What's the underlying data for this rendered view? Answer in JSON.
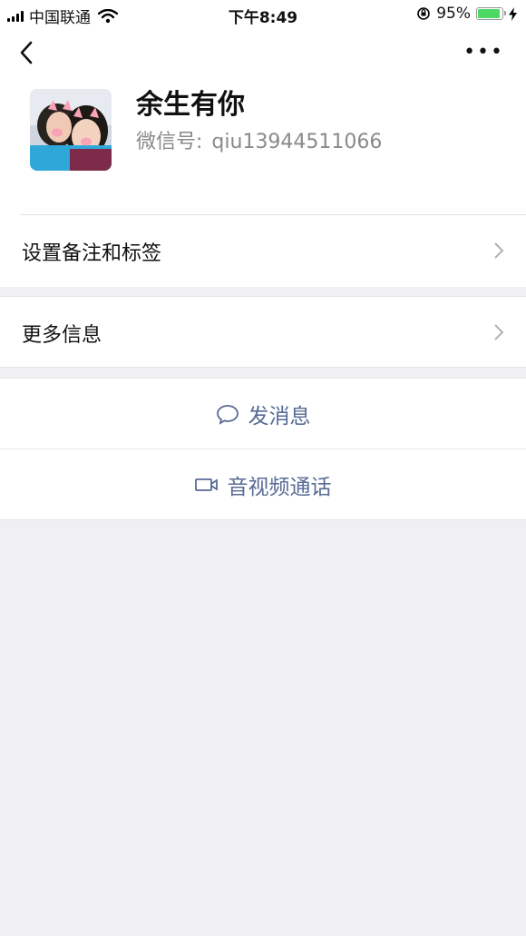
{
  "status": {
    "carrier": "中国联通",
    "time": "下午8:49",
    "battery": "95%",
    "battery_level": 0.95,
    "battery_color": "#4cd964"
  },
  "nav": {
    "back_icon": "chevron-left-icon",
    "more_icon": "ellipsis-icon"
  },
  "profile": {
    "name": "余生有你",
    "wechat_label": "微信号:",
    "wechat_id": "qiu13944511066",
    "avatar": "profile-photo"
  },
  "menu": {
    "remark_label": "设置备注和标签",
    "more_info_label": "更多信息"
  },
  "actions": {
    "send_message": "发消息",
    "video_call": "音视频通话",
    "accent": "#576b95"
  }
}
